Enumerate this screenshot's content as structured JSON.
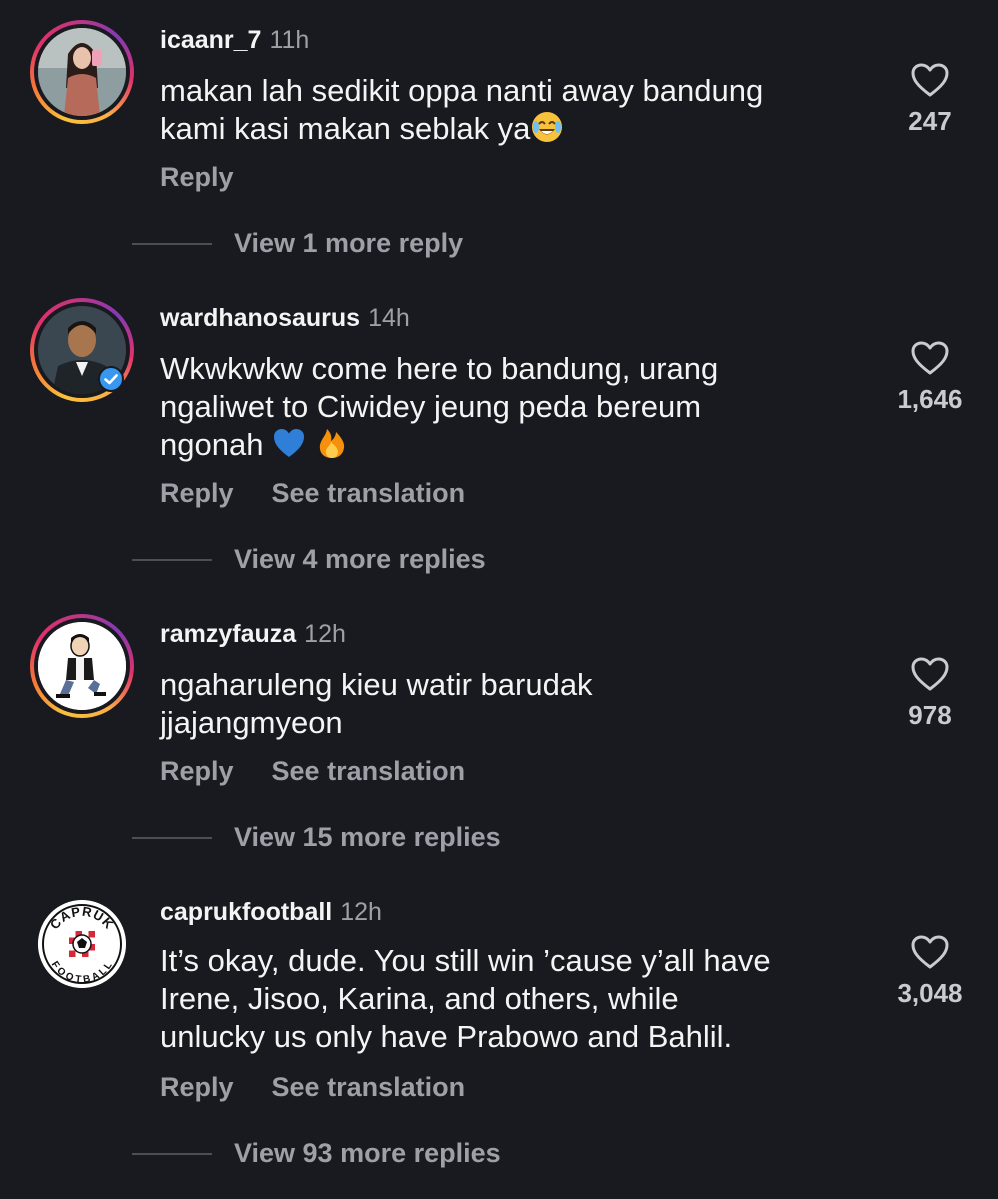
{
  "comments": [
    {
      "username": "icaanr_7",
      "time": "11h",
      "text_lines": [
        "makan lah sedikit oppa nanti away bandung",
        "kami kasi makan seblak ya"
      ],
      "emoji": "face-with-tears-of-joy",
      "reply_label": "Reply",
      "translate_label": "",
      "likes": "247",
      "view_more": "View 1 more reply",
      "avatar": "profile-photo-woman"
    },
    {
      "username": "wardhanosaurus",
      "time": "14h",
      "text_lines": [
        "Wkwkwkw come here to bandung, urang",
        "ngaliwet to Ciwidey jeung peda bereum",
        "ngonah"
      ],
      "emoji_trailing": [
        "blue-heart",
        "fire"
      ],
      "reply_label": "Reply",
      "translate_label": "See translation",
      "likes": "1,646",
      "view_more": "View 4 more replies",
      "avatar": "profile-photo-man-verified"
    },
    {
      "username": "ramzyfauza",
      "time": "12h",
      "text_lines": [
        "ngaharuleng kieu watir barudak",
        "jjajangmyeon"
      ],
      "reply_label": "Reply",
      "translate_label": "See translation",
      "likes": "978",
      "view_more": "View 15 more replies",
      "avatar": "cartoon-figure"
    },
    {
      "username": "capruk​football",
      "time": "12h",
      "text_lines": [
        "It’s okay, dude. You still win ’cause y’all have",
        "Irene, Jisoo, Karina, and others, while",
        "unlucky us only have Prabowo and Bahlil."
      ],
      "reply_label": "Reply",
      "translate_label": "See translation",
      "likes": "3,048",
      "view_more": "View 93 more replies",
      "avatar": "capruk-football-logo",
      "logo_text_top": "CAPRUK",
      "logo_text_bottom": "FOOTBALL"
    }
  ],
  "colors": {
    "background": "#181a1f",
    "primary_text": "#f4f4f5",
    "secondary_text": "#9da0a6",
    "verified_blue": "#3897f0"
  }
}
